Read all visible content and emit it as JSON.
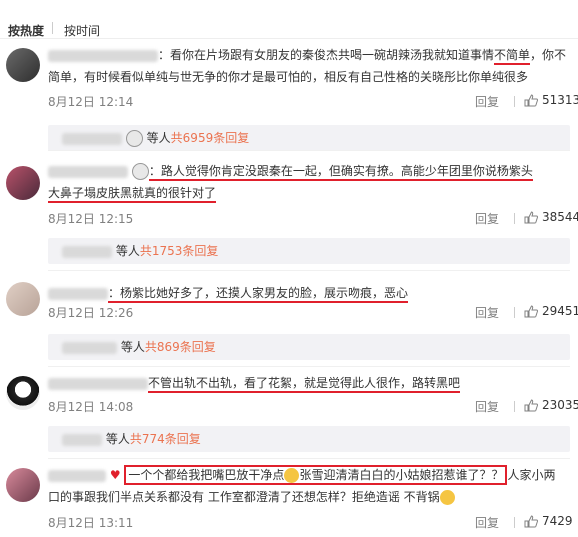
{
  "tabs": {
    "hot": "按热度",
    "time": "按时间"
  },
  "comments": [
    {
      "text": "：看你在片场跟有女朋友的秦俊杰共喝一碗胡辣汤我就知道事情",
      "text_ul": "不简单",
      "text2": "，你不简单，有时候看似单纯与世无争的你才是最可怕的，相反有自己性格的关晓彤比你单纯很多",
      "date": "8月12日 12:14",
      "reply": "回复",
      "likes": "51313",
      "sub": {
        "suffix": "等人",
        "more": "共6959条回复"
      }
    },
    {
      "text_ul": "：路人觉得你肯定没跟秦在一起，但确实有撩。高能少年团里你说杨紫头",
      "text_ul2": "大鼻子塌皮肤黑就真的很针对了",
      "date": "8月12日 12:15",
      "reply": "回复",
      "likes": "38544",
      "sub": {
        "suffix": "等人",
        "more": "共1753条回复"
      }
    },
    {
      "text_ul": "：杨紫比她好多了，还摸人家男友的脸，展示吻痕，恶心",
      "date": "8月12日 12:26",
      "reply": "回复",
      "likes": "29451",
      "sub": {
        "suffix": "等人",
        "more": "共869条回复"
      }
    },
    {
      "text_ul": "不管出轨不出轨，看了花絮，就是觉得此人很作，路转黑吧",
      "date": "8月12日 14:08",
      "reply": "回复",
      "likes": "23035",
      "sub": {
        "suffix": "等人",
        "more": "共774条回复"
      }
    },
    {
      "text_box": "一个个都给我把嘴巴放干净点",
      "text_box2": "张雪迎清清白白的小姑娘招惹谁了？？",
      "text_tail": "人家小两",
      "text2": "口的事跟我们半点关系都没有 工作室都澄清了还想怎样？拒绝造谣 不背锅",
      "date": "8月12日 13:11",
      "reply": "回复",
      "likes": "7429"
    }
  ],
  "colors": {
    "accent": "#eb7350",
    "highlight": "#e0202c",
    "meta": "#808080"
  }
}
